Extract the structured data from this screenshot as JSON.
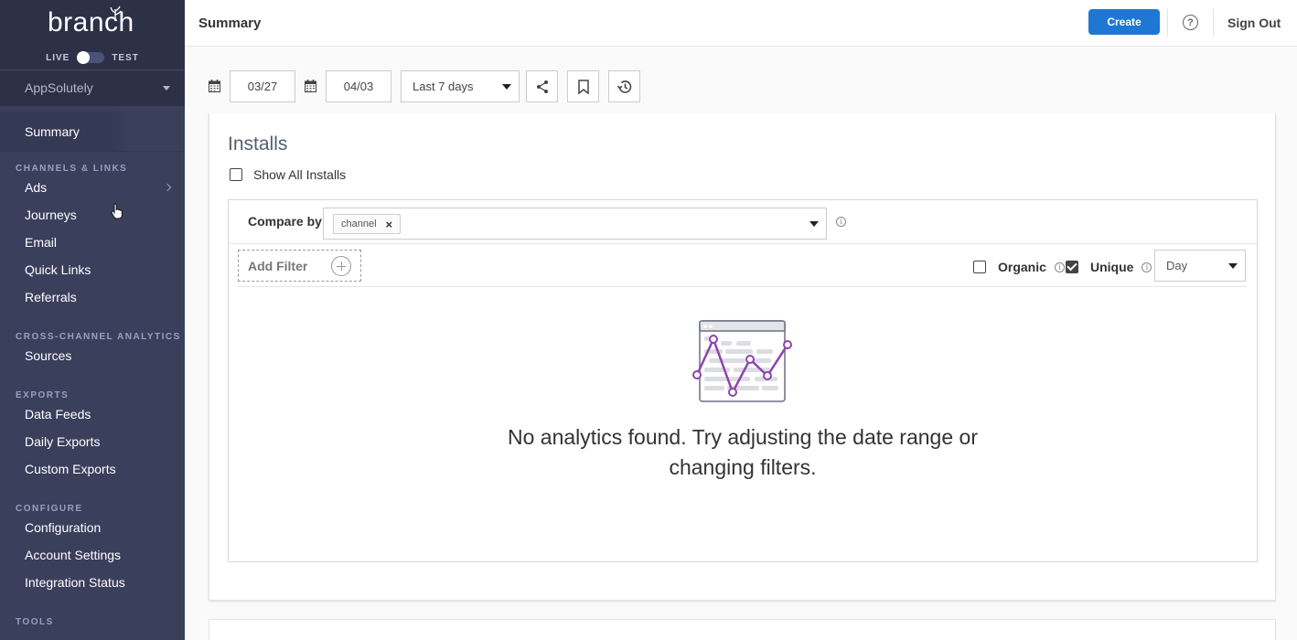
{
  "sidebar": {
    "logo": "branch",
    "env_live": "LIVE",
    "env_test": "TEST",
    "app_name": "AppSolutely",
    "summary": "Summary",
    "sections": [
      {
        "title": "CHANNELS & LINKS",
        "items": [
          "Ads",
          "Journeys",
          "Email",
          "Quick Links",
          "Referrals"
        ]
      },
      {
        "title": "CROSS-CHANNEL ANALYTICS",
        "items": [
          "Sources"
        ]
      },
      {
        "title": "EXPORTS",
        "items": [
          "Data Feeds",
          "Daily Exports",
          "Custom Exports"
        ]
      },
      {
        "title": "CONFIGURE",
        "items": [
          "Configuration",
          "Account Settings",
          "Integration Status"
        ]
      },
      {
        "title": "TOOLS",
        "items": []
      }
    ]
  },
  "header": {
    "title": "Summary",
    "create": "Create",
    "help": "?",
    "sign_out": "Sign Out"
  },
  "toolbar": {
    "start_date": "03/27",
    "end_date": "04/03",
    "range": "Last 7 days"
  },
  "installs": {
    "title": "Installs",
    "show_all": "Show All Installs",
    "compare_by": "Compare by",
    "compare_chip": "channel",
    "add_filter": "Add Filter",
    "organic": "Organic",
    "unique": "Unique",
    "interval": "Day",
    "empty_message": "No analytics found. Try adjusting the date range or changing filters."
  },
  "colors": {
    "sidebar_bg": "#3a3f5c",
    "accent": "#1f77d4",
    "chart_purple": "#8e44ad"
  }
}
